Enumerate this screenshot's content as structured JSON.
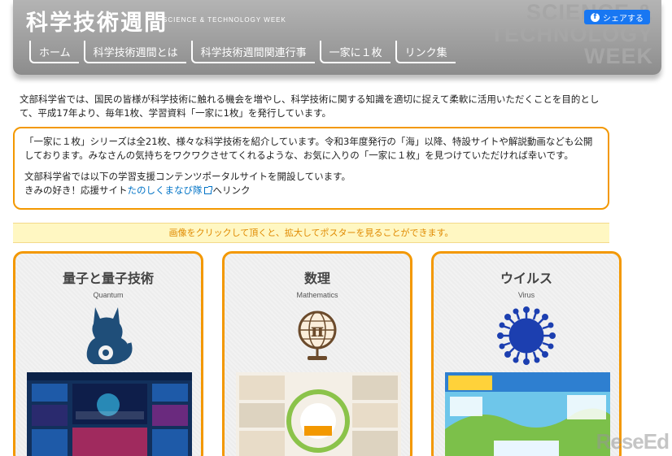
{
  "header": {
    "logo_text": "科学技術週間",
    "logo_sub": "SCIENCE & TECHNOLOGY WEEK",
    "bg_text": [
      "SCIENCE &",
      "TECHNOLOGY",
      "WEEK"
    ],
    "share_label": "シェアする",
    "nav": [
      "ホーム",
      "科学技術週間とは",
      "科学技術週間関連行事",
      "一家に１枚",
      "リンク集"
    ]
  },
  "intro": "文部科学省では、国民の皆様が科学技術に触れる機会を増やし、科学技術に関する知識を適切に捉えて柔軟に活用いただくことを目的として、平成17年より、毎年1枚、学習資料「一家に1枚」を発行しています。",
  "orange_box": {
    "para1": "「一家に１枚」シリーズは全21枚、様々な科学技術を紹介しています。令和3年度発行の「海」以降、特設サイトや解説動画なども公開しております。みなさんの気持ちをワクワクさせてくれるような、お気に入りの「一家に１枚」を見つけていただければ幸いです。",
    "para2": "文部科学省では以下の学習支援コンテンツポータルサイトを開設しています。",
    "para3_prefix": "きみの好き！応援サイト",
    "para3_link": "たのしくまなび隊",
    "para3_suffix": "へリンク"
  },
  "notice": "画像をクリックして頂くと、拡大してポスターを見ることができます。",
  "cards": [
    {
      "title": "量子と量子技術",
      "subtitle": "Quantum",
      "poster_title": "量子と量子技術"
    },
    {
      "title": "数理",
      "subtitle": "Mathematics",
      "poster_title": "数理"
    },
    {
      "title": "ウイルス",
      "subtitle": "Virus",
      "poster_title": "ウイルス"
    }
  ],
  "watermark": "ReseEd",
  "colors": {
    "accent": "#f39800",
    "link": "#0073c6",
    "notice_text": "#e08a00",
    "icon_blue": "#1f4e79",
    "virus_blue": "#1c3fb0"
  }
}
